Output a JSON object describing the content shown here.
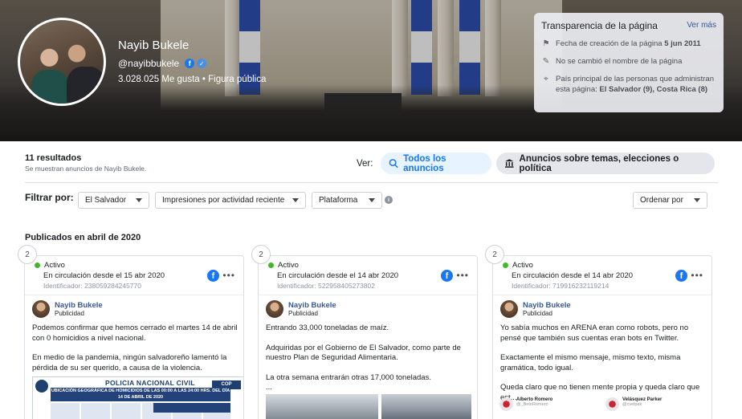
{
  "page": {
    "name": "Nayib Bukele",
    "handle": "@nayibbukele",
    "likes": "3.028.025 Me gusta",
    "category": "Figura pública"
  },
  "transparency": {
    "title": "Transparencia de la página",
    "see_more": "Ver más",
    "created_label": "Fecha de creación de la página",
    "created_date": "5 jun 2011",
    "name_change": "No se cambió el nombre de la página",
    "countries_label": "País principal de las personas que administran esta página:",
    "countries": "El Salvador (9), Costa Rica (8)"
  },
  "results": {
    "count": "11 resultados",
    "subtitle": "Se muestran anuncios de Nayib Bukele."
  },
  "view": {
    "label": "Ver:",
    "all_ads": "Todos los anuncios",
    "political_ads": "Anuncios sobre temas, elecciones o política"
  },
  "filters": {
    "label": "Filtrar por:",
    "country": "El Salvador",
    "impressions": "Impresiones por actividad reciente",
    "platform": "Plataforma",
    "order": "Ordenar por"
  },
  "section": {
    "title": "Publicados en abril de 2020"
  },
  "cards": [
    {
      "badge": "2",
      "status": "Activo",
      "circulation": "En circulación desde el 15 abr 2020",
      "identifier": "Identificador: 238059284245770",
      "author": "Nayib Bukele",
      "sponsored": "Publicidad",
      "text1": "Podemos confirmar que hemos cerrado el martes 14 de abril con 0 homicidios a nivel nacional.",
      "text2": "En medio de la pandemia, ningún salvadoreño lamentó la pérdida de su ser querido, a causa de la violencia.",
      "doc_title": "POLICIA NACIONAL CIVIL",
      "doc_band": "UBICACIÓN GEOGRÁFICA DE HOMICIDIOS DE LAS 00:00 A LAS 24:00 HRS. DEL DÍA 14 DE ABRIL DE 2020",
      "doc_right": "COP"
    },
    {
      "badge": "2",
      "status": "Activo",
      "circulation": "En circulación desde el 14 abr 2020",
      "identifier": "Identificador: 522958405273802",
      "author": "Nayib Bukele",
      "sponsored": "Publicidad",
      "text1": "Entrando 33,000 toneladas de maíz.",
      "text2": "Adquiridas por el Gobierno de El Salvador, como parte de nuestro Plan de Seguridad Alimentaria.",
      "text3": "La otra semana entrarán otras 17,000 toneladas.",
      "ellipsis": "..."
    },
    {
      "badge": "2",
      "status": "Activo",
      "circulation": "En circulación desde el 14 abr 2020",
      "identifier": "Identificador: 719916232119214",
      "author": "Nayib Bukele",
      "sponsored": "Publicidad",
      "text1": "Yo sabía muchos en ARENA eran como robots, pero no pensé que también sus cuentas eran bots en Twitter.",
      "text2": "Exactamente el mismo mensaje, mismo texto, misma gramática, todo igual.",
      "text3": "Queda claro que no tienen mente propia y queda claro que est...",
      "tweet1_name": "Alberto Romero",
      "tweet1_handle": "@_BetoRomero",
      "tweet2_name": "Velásquez Parker",
      "tweet2_handle": "@cvelpak"
    }
  ],
  "icons": {
    "facebook": "facebook-icon",
    "verified": "verified-badge-icon",
    "search": "search-icon",
    "bank": "bank-icon",
    "info": "info-icon",
    "more": "more-icon"
  }
}
